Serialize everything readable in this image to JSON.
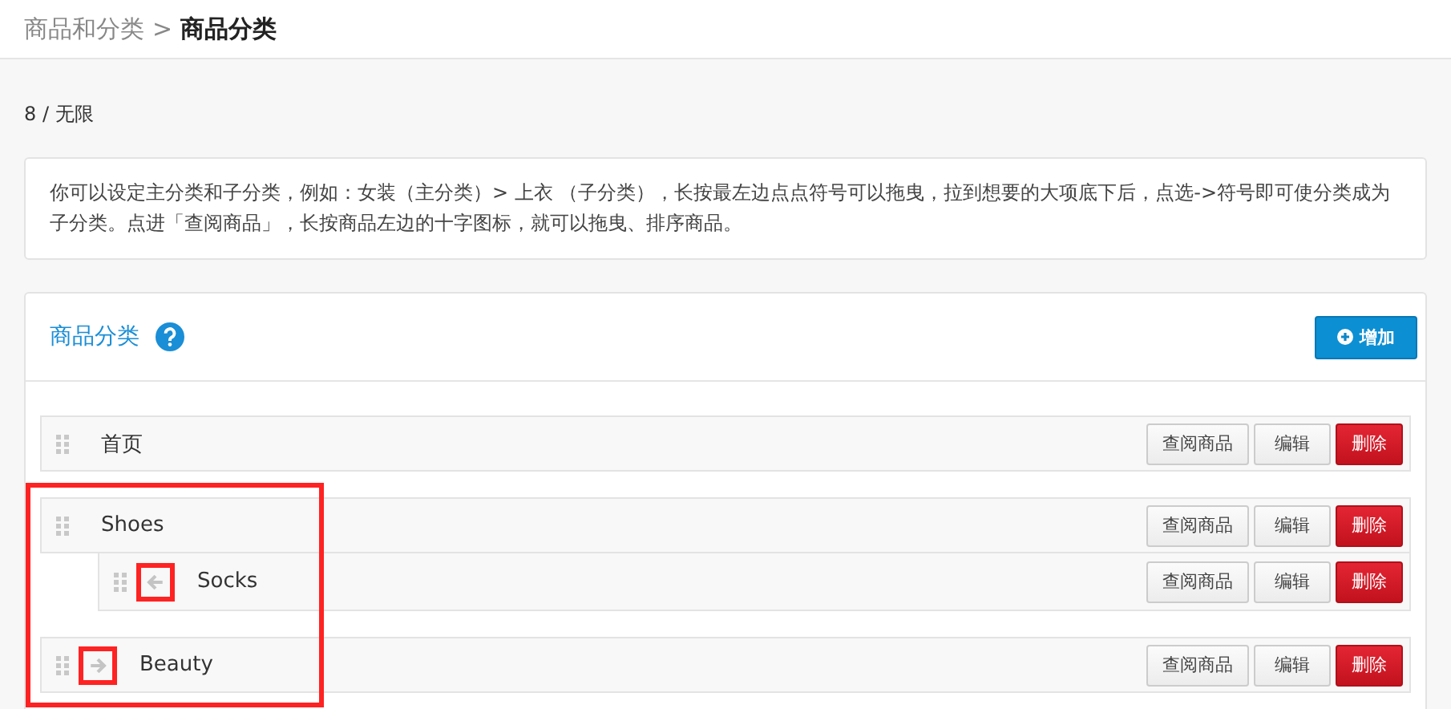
{
  "breadcrumb": {
    "parent": "商品和分类",
    "separator": ">",
    "current": "商品分类"
  },
  "quota": "8 / 无限",
  "info": "你可以设定主分类和子分类，例如：女装（主分类）> 上衣 （子分类），长按最左边点点符号可以拖曳，拉到想要的大项底下后，点选->符号即可使分类成为子分类。点进「查阅商品」，长按商品左边的十字图标，就可以拖曳、排序商品。",
  "panel": {
    "title": "商品分类",
    "add_button": "增加",
    "categories": [
      {
        "name": "首页",
        "buttons": {
          "view": "查阅商品",
          "edit": "编辑",
          "delete": "删除"
        }
      },
      {
        "name": "Shoes",
        "buttons": {
          "view": "查阅商品",
          "edit": "编辑",
          "delete": "删除"
        },
        "children": [
          {
            "name": "Socks",
            "arrow": {
              "kind": "left",
              "highlighted": true
            },
            "buttons": {
              "view": "查阅商品",
              "edit": "编辑",
              "delete": "删除"
            }
          }
        ]
      },
      {
        "name": "Beauty",
        "arrow": {
          "kind": "right",
          "highlighted": true
        },
        "buttons": {
          "view": "查阅商品",
          "edit": "编辑",
          "delete": "删除"
        }
      }
    ]
  },
  "callout_frame": {
    "shown": true
  }
}
